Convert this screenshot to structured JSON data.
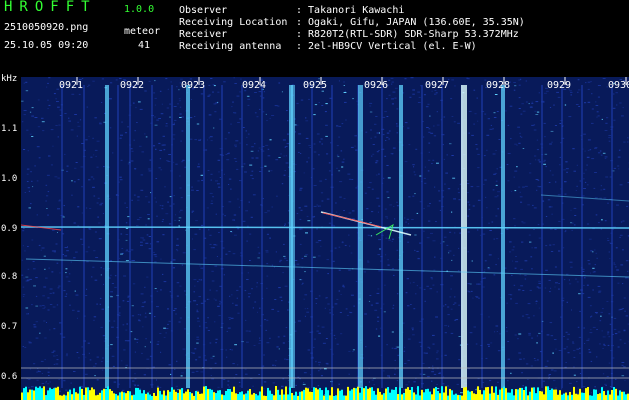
{
  "app": {
    "logo": "HROFFT",
    "version": "1.0.0",
    "filename": "2510050920.png",
    "datetime": "25.10.05 09:20",
    "meteor_label": "meteor",
    "meteor_count": "41"
  },
  "info": {
    "rows": [
      {
        "key": "Observer",
        "value": ": Takanori Kawachi"
      },
      {
        "key": "Receiving Location",
        "value": ": Ogaki, Gifu, JAPAN (136.60E, 35.35N)"
      },
      {
        "key": "Receiver",
        "value": ": R820T2(RTL-SDR) SDR-Sharp 53.372MHz"
      },
      {
        "key": "Receiving antenna",
        "value": ": 2el-HB9CV Vertical (el. E-W)"
      }
    ]
  },
  "chart_data": {
    "type": "heatmap",
    "ylabel": "kHz",
    "y_ticks": [
      "1.1",
      "1.0",
      "0.9",
      "0.8",
      "0.7",
      "0.6"
    ],
    "x_ticks": [
      "0921",
      "0922",
      "0923",
      "0924",
      "0925",
      "0926",
      "0927",
      "0928",
      "0929",
      "0930"
    ],
    "colors": {
      "background": "#081a5a",
      "noise": "#1d3aa8",
      "signal": "#5fd3ff",
      "strong": "#e0ffff",
      "meteor_head": "#ff4040",
      "yellow_bar": "#ffff00",
      "cyan_bar": "#00ffff"
    }
  }
}
